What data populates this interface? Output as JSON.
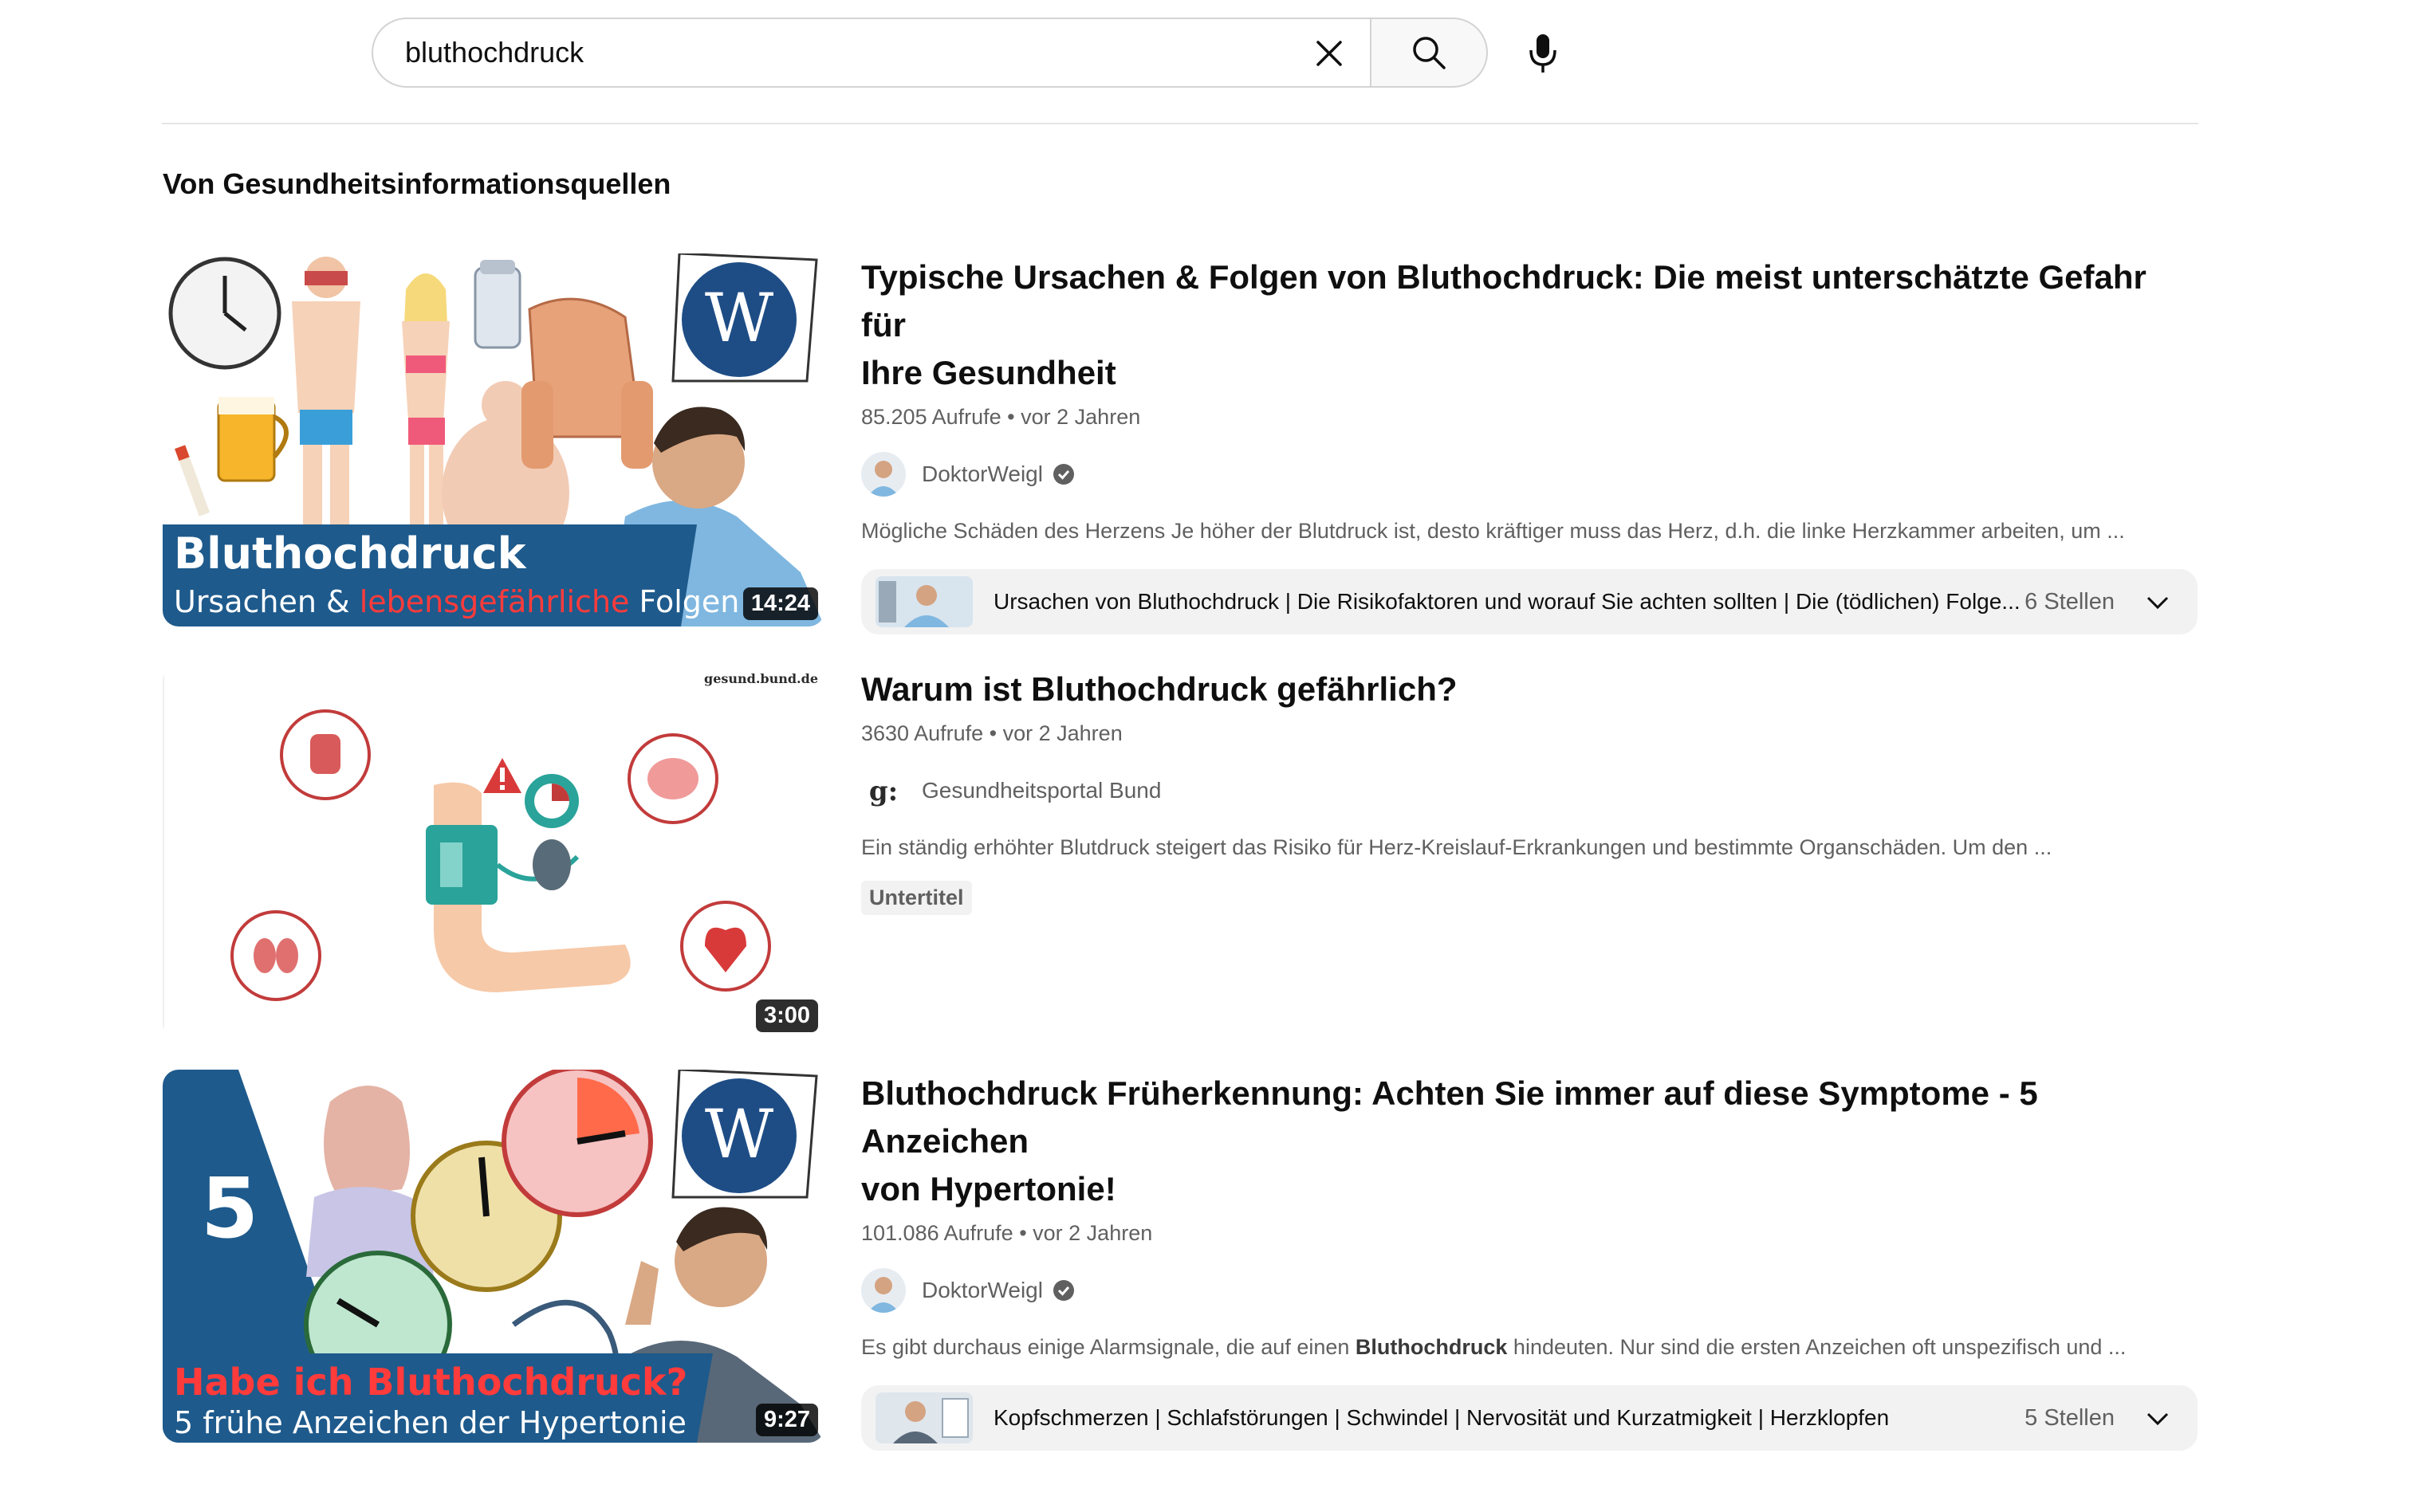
{
  "search": {
    "query": "bluthochdruck",
    "clear_icon": "close-icon",
    "search_icon": "search-icon",
    "mic_icon": "microphone-icon"
  },
  "section": {
    "title": "Von Gesundheitsinformationsquellen"
  },
  "results": [
    {
      "thumbnail": {
        "headline": "Bluthochdruck",
        "sub_white_1": "Ursachen & ",
        "sub_red": "lebensgefährliche",
        "sub_white_2": " Folgen",
        "logo_letter": "W"
      },
      "duration": "14:24",
      "title_line1": "Typische Ursachen & Folgen von Bluthochdruck: Die meist unterschätzte Gefahr für",
      "title_line2": "Ihre Gesundheit",
      "views": "85.205 Aufrufe",
      "age": "vor 2 Jahren",
      "channel": "DoktorWeigl",
      "verified": true,
      "description": "Mögliche Schäden des Herzens Je höher der Blutdruck ist, desto kräftiger muss das Herz, d.h. die linke Herzkammer arbeiten, um ...",
      "chapters": {
        "text": "Ursachen von Bluthochdruck | Die Risikofaktoren und worauf Sie achten sollten | Die (tödlichen) Folge...",
        "count": "6 Stellen"
      }
    },
    {
      "thumbnail": {
        "watermark": "gesund.bund.de"
      },
      "duration": "3:00",
      "title_line1": "Warum ist Bluthochdruck gefährlich?",
      "views": "3630 Aufrufe",
      "age": "vor 2 Jahren",
      "channel": "Gesundheitsportal Bund",
      "channel_logo": "g:",
      "description": "Ein ständig erhöhter Blutdruck steigert das Risiko für Herz-Kreislauf-Erkrankungen und bestimmte Organschäden. Um den ...",
      "badge": "Untertitel"
    },
    {
      "thumbnail": {
        "number": "5",
        "headline": "Habe ich Bluthochdruck?",
        "subline": "5 frühe Anzeichen der Hypertonie",
        "logo_letter": "W"
      },
      "duration": "9:27",
      "title_line1": "Bluthochdruck Früherkennung: Achten Sie immer auf diese Symptome - 5 Anzeichen",
      "title_line2": "von Hypertonie!",
      "views": "101.086 Aufrufe",
      "age": "vor 2 Jahren",
      "channel": "DoktorWeigl",
      "verified": true,
      "description_pre": "Es gibt durchaus einige Alarmsignale, die auf einen ",
      "description_bold": "Bluthochdruck",
      "description_post": " hindeuten. Nur sind die ersten Anzeichen oft unspezifisch und ...",
      "chapters": {
        "text": "Kopfschmerzen | Schlafstörungen | Schwindel | Nervosität und Kurzatmigkeit | Herzklopfen",
        "count": "5 Stellen"
      }
    }
  ],
  "separator": "•",
  "colors": {
    "brand_blue": "#1e5a8c",
    "thumb_red": "#ff3b3b",
    "scrub_red": "#c23b3b",
    "meta_gray": "#606060"
  }
}
